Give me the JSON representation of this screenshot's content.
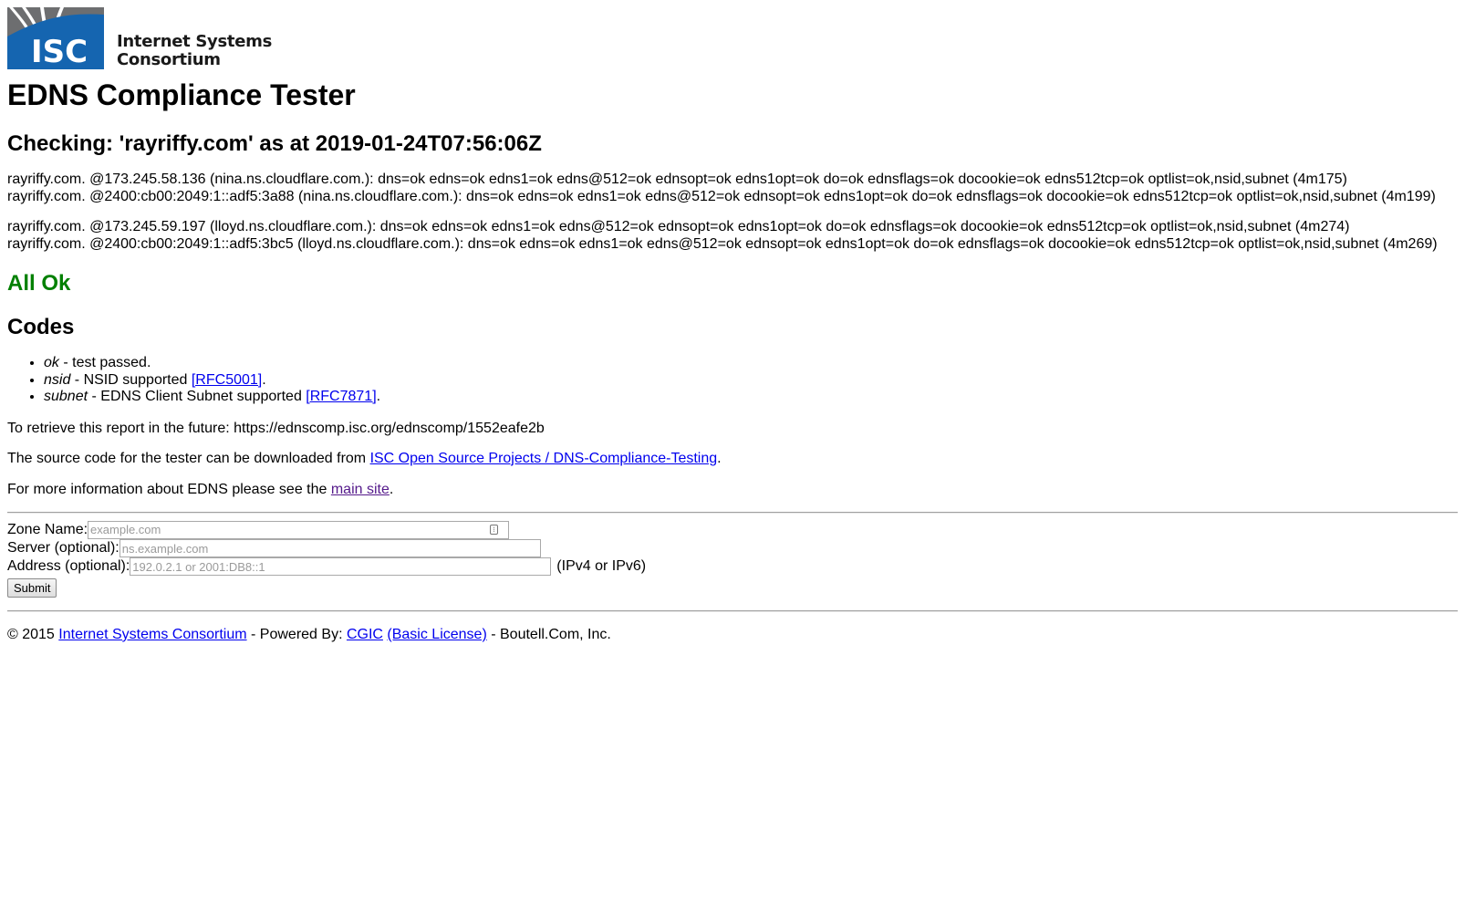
{
  "logo": {
    "mark_text": "ISC",
    "line1": "Internet Systems",
    "line2": "Consortium",
    "colors": {
      "blue": "#1565b0",
      "gray": "#6d6e70"
    }
  },
  "title": "EDNS Compliance Tester",
  "checking_heading": "Checking: 'rayriffy.com' as at 2019-01-24T07:56:06Z",
  "check_groups": [
    [
      "rayriffy.com. @173.245.58.136 (nina.ns.cloudflare.com.): dns=ok edns=ok edns1=ok edns@512=ok ednsopt=ok edns1opt=ok do=ok ednsflags=ok docookie=ok edns512tcp=ok optlist=ok,nsid,subnet (4m175)",
      "rayriffy.com. @2400:cb00:2049:1::adf5:3a88 (nina.ns.cloudflare.com.): dns=ok edns=ok edns1=ok edns@512=ok ednsopt=ok edns1opt=ok do=ok ednsflags=ok docookie=ok edns512tcp=ok optlist=ok,nsid,subnet (4m199)"
    ],
    [
      "rayriffy.com. @173.245.59.197 (lloyd.ns.cloudflare.com.): dns=ok edns=ok edns1=ok edns@512=ok ednsopt=ok edns1opt=ok do=ok ednsflags=ok docookie=ok edns512tcp=ok optlist=ok,nsid,subnet (4m274)",
      "rayriffy.com. @2400:cb00:2049:1::adf5:3bc5 (lloyd.ns.cloudflare.com.): dns=ok edns=ok edns1=ok edns@512=ok ednsopt=ok edns1opt=ok do=ok ednsflags=ok docookie=ok edns512tcp=ok optlist=ok,nsid,subnet (4m269)"
    ]
  ],
  "status": {
    "text": "All Ok",
    "color": "#008000"
  },
  "codes": {
    "heading": "Codes",
    "items": [
      {
        "code": "ok",
        "desc": " - test passed.",
        "link": "",
        "after": ""
      },
      {
        "code": "nsid",
        "desc": " - NSID supported ",
        "link": "[RFC5001]",
        "after": "."
      },
      {
        "code": "subnet",
        "desc": " - EDNS Client Subnet supported ",
        "link": "[RFC7871]",
        "after": "."
      }
    ]
  },
  "retrieve": {
    "prefix": "To retrieve this report in the future: ",
    "url": "https://ednscomp.isc.org/ednscomp/1552eafe2b"
  },
  "source": {
    "prefix": "The source code for the tester can be downloaded from ",
    "link": "ISC Open Source Projects / DNS-Compliance-Testing",
    "suffix": "."
  },
  "more": {
    "prefix": "For more information about EDNS please see the ",
    "link": "main site",
    "suffix": "."
  },
  "form": {
    "zone_label": "Zone Name:",
    "zone_placeholder": "example.com",
    "zone_value": "",
    "server_label": "Server (optional):",
    "server_placeholder": "ns.example.com",
    "server_value": "",
    "address_label": "Address (optional):",
    "address_placeholder": "192.0.2.1 or 2001:DB8::1",
    "address_value": "",
    "address_hint": "(IPv4 or IPv6)",
    "submit_label": "Submit"
  },
  "footer": {
    "copyright": "© 2015 ",
    "isc_link": "Internet Systems Consortium",
    "powered": " - Powered By: ",
    "cgic_link": "CGIC",
    "license_link": "(Basic License)",
    "boutell": " - Boutell.Com, Inc."
  }
}
